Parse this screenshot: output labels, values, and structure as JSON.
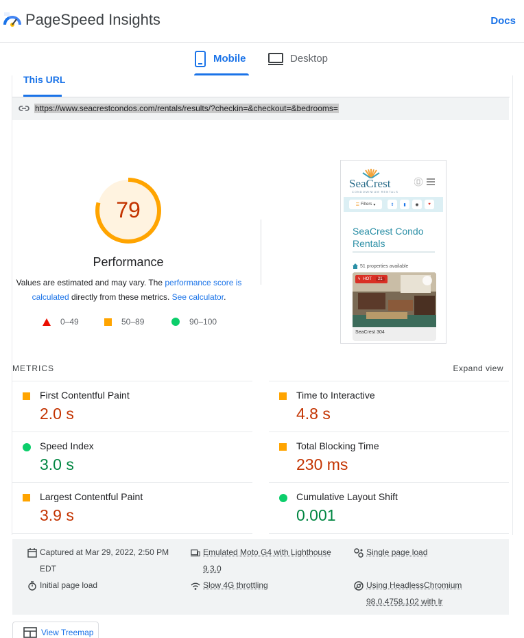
{
  "header": {
    "app_title": "PageSpeed Insights",
    "docs_label": "Docs"
  },
  "device_tabs": [
    {
      "label": "Mobile",
      "active": true,
      "icon": "smartphone-icon"
    },
    {
      "label": "Desktop",
      "active": false,
      "icon": "monitor-icon"
    }
  ],
  "url_section": {
    "tab_label": "This URL",
    "url": "https://www.seacrestcondos.com/rentals/results/?checkin=&checkout=&bedrooms="
  },
  "score": {
    "value": 79,
    "fraction": 0.79,
    "label": "Performance",
    "color": "#ffa400",
    "text_color": "#c33300"
  },
  "description": {
    "prefix": "Values are estimated and may vary. The ",
    "link1": "performance score is calculated",
    "middle": " directly from these metrics. ",
    "link2": "See calculator",
    "suffix": "."
  },
  "legend": [
    {
      "range": "0–49",
      "shape": "triangle",
      "color": "#eb0f00"
    },
    {
      "range": "50–89",
      "shape": "square",
      "color": "#ffa400"
    },
    {
      "range": "90–100",
      "shape": "circle",
      "color": "#0cce6b"
    }
  ],
  "screenshot": {
    "brand": "SeaCrest",
    "brand_sub": "CONDOMINIUM RENTALS",
    "filters_label": "Filters",
    "heading": "SeaCrest Condo Rentals",
    "available": "51 properties available",
    "badge": "HOT",
    "badge_count": "21",
    "card_title": "SeaCrest 304"
  },
  "metrics": {
    "title": "METRICS",
    "expand_label": "Expand view",
    "items": [
      {
        "name": "First Contentful Paint",
        "value": "2.0 s",
        "rating": "average"
      },
      {
        "name": "Time to Interactive",
        "value": "4.8 s",
        "rating": "average"
      },
      {
        "name": "Speed Index",
        "value": "3.0 s",
        "rating": "good"
      },
      {
        "name": "Total Blocking Time",
        "value": "230 ms",
        "rating": "average"
      },
      {
        "name": "Largest Contentful Paint",
        "value": "3.9 s",
        "rating": "average"
      },
      {
        "name": "Cumulative Layout Shift",
        "value": "0.001",
        "rating": "good"
      }
    ]
  },
  "run_info": {
    "captured_line1": "Captured at Mar 29, 2022, 2:50 PM",
    "captured_line2": "EDT",
    "device_line1": "Emulated Moto G4 with Lighthouse",
    "device_line2": "9.3.0",
    "session": "Single page load",
    "load_type": "Initial page load",
    "throttling": "Slow 4G throttling",
    "browser_line1": "Using HeadlessChromium",
    "browser_line2": "98.0.4758.102 with lr"
  },
  "treemap_label": "View Treemap"
}
